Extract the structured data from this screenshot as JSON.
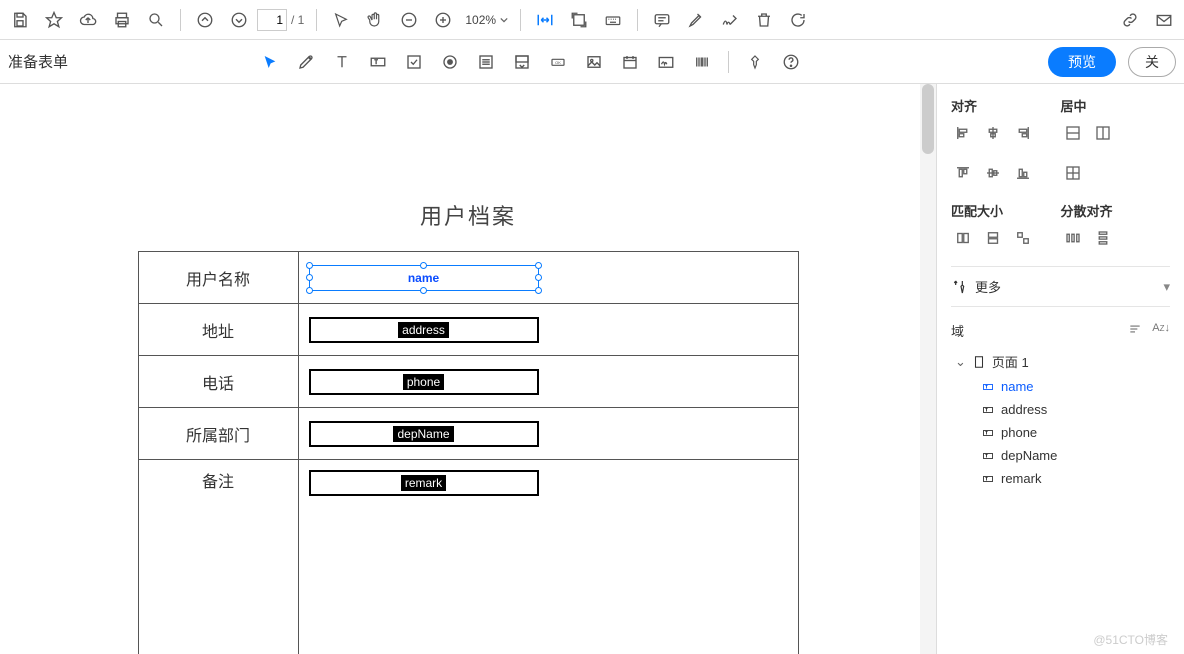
{
  "toolbar": {
    "page_current": "1",
    "page_total": "/ 1",
    "zoom": "102%"
  },
  "toolbar2": {
    "title": "准备表单",
    "preview": "预览",
    "close": "关"
  },
  "doc": {
    "title": "用户档案",
    "rows": [
      {
        "label": "用户名称",
        "field": "name",
        "selected": true
      },
      {
        "label": "地址",
        "field": "address",
        "selected": false
      },
      {
        "label": "电话",
        "field": "phone",
        "selected": false
      },
      {
        "label": "所属部门",
        "field": "depName",
        "selected": false
      },
      {
        "label": "备注",
        "field": "remark",
        "selected": false,
        "tall": true
      }
    ]
  },
  "rpanel": {
    "align_label": "对齐",
    "center_label": "居中",
    "match_label": "匹配大小",
    "distribute_label": "分散对齐",
    "more_label": "更多",
    "fields_label": "域",
    "page_label": "页面 1",
    "fields": [
      "name",
      "address",
      "phone",
      "depName",
      "remark"
    ],
    "selected_field": "name"
  },
  "watermark": "@51CTO博客"
}
